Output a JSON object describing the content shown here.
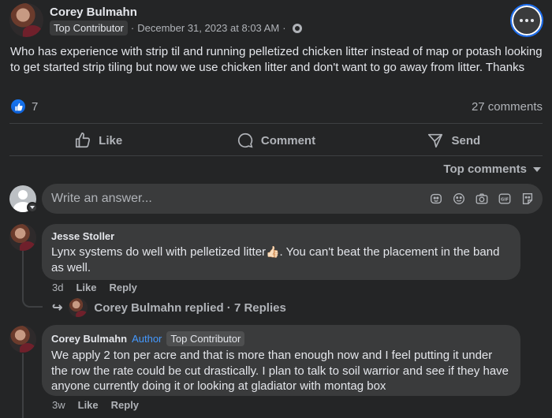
{
  "post": {
    "author": "Corey Bulmahn",
    "badge": "Top Contributor",
    "date": "December 31, 2023 at 8:03 AM",
    "separator": "·",
    "text": "Who has experience with strip til and running pelletized chicken litter instead of map or potash looking to get started strip tiling but now we use chicken litter and don't want to go away from litter. Thanks",
    "reaction_count": "7",
    "comments_count": "27 comments"
  },
  "actions": {
    "like": "Like",
    "comment": "Comment",
    "send": "Send"
  },
  "sort": {
    "label": "Top comments"
  },
  "composer": {
    "placeholder": "Write an answer..."
  },
  "comments": [
    {
      "author": "Jesse Stoller",
      "text_before": "Lynx systems do well with pelletized litter",
      "emoji": "👍🏻",
      "text_after": ". You can't beat the placement in the band as well.",
      "age": "3d",
      "like": "Like",
      "reply": "Reply",
      "replies_summary": "Corey Bulmahn replied · 7 Replies"
    },
    {
      "author": "Corey Bulmahn",
      "author_badge": "Author",
      "badge": "Top Contributor",
      "text": "We apply 2 ton per acre and that is more than enough now and I feel putting it under the row the rate could be cut drastically. I plan to talk to soil warrior and see if they have anyone currently doing it or looking at gladiator with montag box",
      "age": "3w",
      "like": "Like",
      "reply": "Reply"
    }
  ],
  "colors": {
    "background": "#242526",
    "surface": "#3a3b3c",
    "text_primary": "#e4e6eb",
    "text_secondary": "#b0b3b8",
    "accent": "#1877f2",
    "author_badge": "#4599ff"
  },
  "icons": [
    "more-icon",
    "globe-icon",
    "like-reaction-icon",
    "thumbs-up-icon",
    "comment-icon",
    "send-icon",
    "caret-down-icon",
    "sticker-icon",
    "emoji-icon",
    "camera-icon",
    "gif-icon",
    "avatar-sticker-icon",
    "reply-arrow-icon"
  ]
}
